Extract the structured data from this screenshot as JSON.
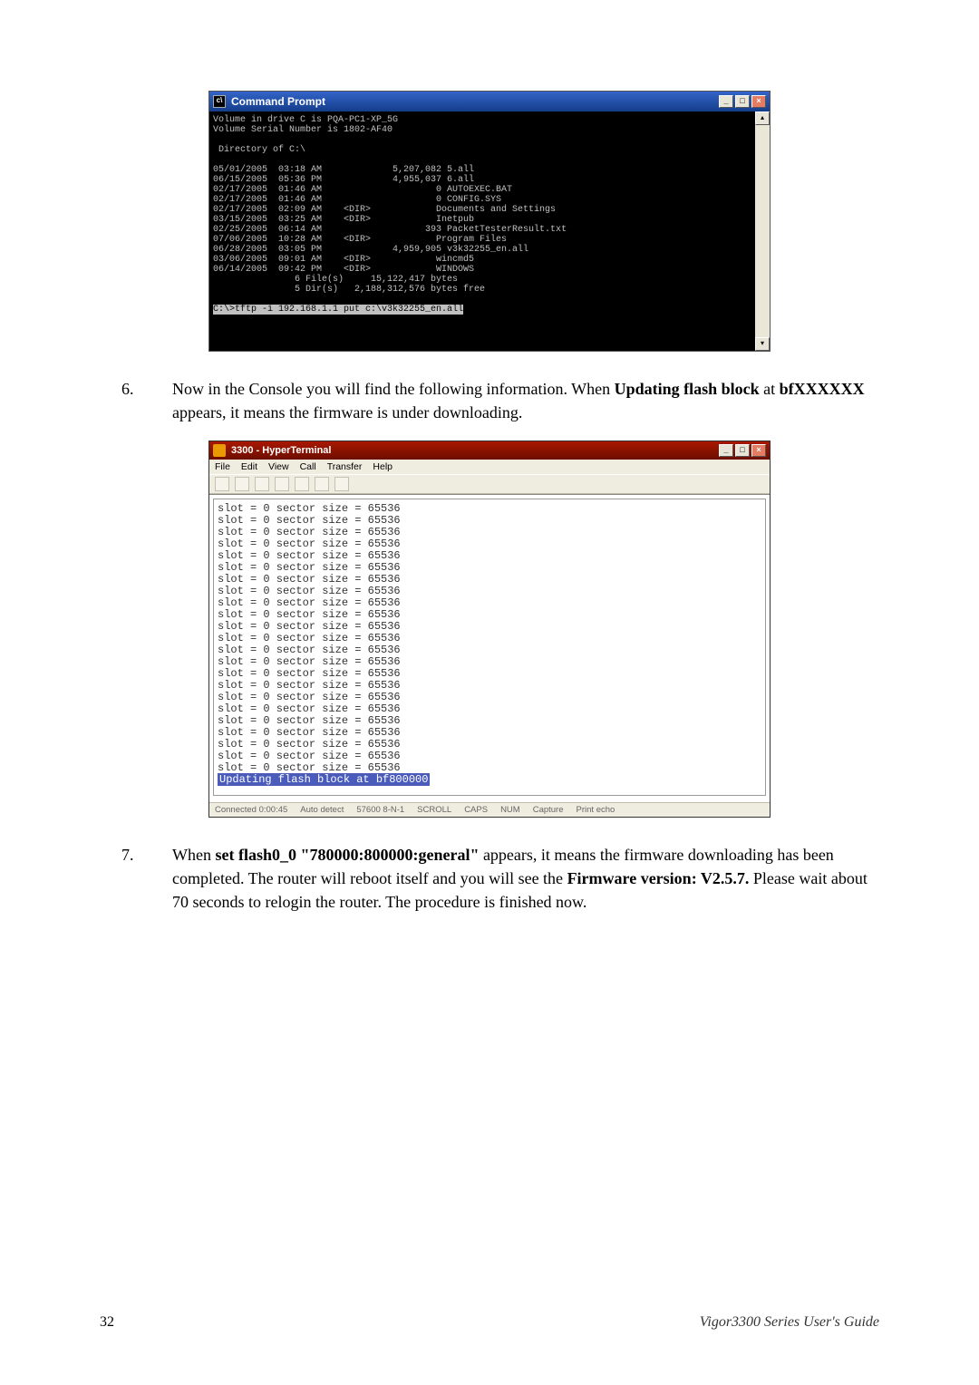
{
  "cmd": {
    "title": "Command Prompt",
    "volume_line": "Volume in drive C is PQA-PC1-XP_5G",
    "serial_line": "Volume Serial Number is 1802-AF40",
    "dirof": " Directory of C:\\",
    "rows": [
      "05/01/2005  03:18 AM             5,207,082 5.all",
      "06/15/2005  05:36 PM             4,955,037 6.all",
      "02/17/2005  01:46 AM                     0 AUTOEXEC.BAT",
      "02/17/2005  01:46 AM                     0 CONFIG.SYS",
      "02/17/2005  02:09 AM    <DIR>            Documents and Settings",
      "03/15/2005  03:25 AM    <DIR>            Inetpub",
      "02/25/2005  06:14 AM                   393 PacketTesterResult.txt",
      "07/06/2005  10:28 AM    <DIR>            Program Files",
      "06/28/2005  03:05 PM             4,959,905 v3k32255_en.all",
      "03/06/2005  09:01 AM    <DIR>            wincmd5",
      "06/14/2005  09:42 PM    <DIR>            WINDOWS",
      "               6 File(s)     15,122,417 bytes",
      "               5 Dir(s)   2,188,312,576 bytes free"
    ],
    "prompt": "C:\\>tftp -i 192.168.1.1 put c:\\v3k32255_en.all"
  },
  "step6": {
    "num": "6.",
    "t1": "Now in the Console you will find the following information. When ",
    "b1": "Updating flash block",
    "t2": " at ",
    "b2": "bfXXXXXX",
    "t3": " appears, it means the firmware is under downloading."
  },
  "hyper": {
    "title": "3300 - HyperTerminal",
    "menu": [
      "File",
      "Edit",
      "View",
      "Call",
      "Transfer",
      "Help"
    ],
    "slotline": "slot = 0 sector size = 65536",
    "slot_count": 23,
    "update": "Updating flash block at bf800000",
    "status": [
      "Connected 0:00:45",
      "Auto detect",
      "57600 8-N-1",
      "SCROLL",
      "CAPS",
      "NUM",
      "Capture",
      "Print echo"
    ]
  },
  "step7": {
    "num": "7.",
    "t1": "When ",
    "b1": "set flash0_0 \"780000:800000:general\"",
    "t2": " appears, it means the firmware downloading has been completed. The router will reboot itself and you will see the ",
    "b2": "Firmware version: V2.5.7.",
    "t3": " Please wait about 70 seconds to relogin the router. The procedure is finished now."
  },
  "footer": {
    "page": "32",
    "guide": "Vigor3300 Series User's Guide"
  },
  "winbtn": {
    "min": "_",
    "max": "□",
    "close": "×",
    "up": "▴",
    "dn": "▾"
  }
}
